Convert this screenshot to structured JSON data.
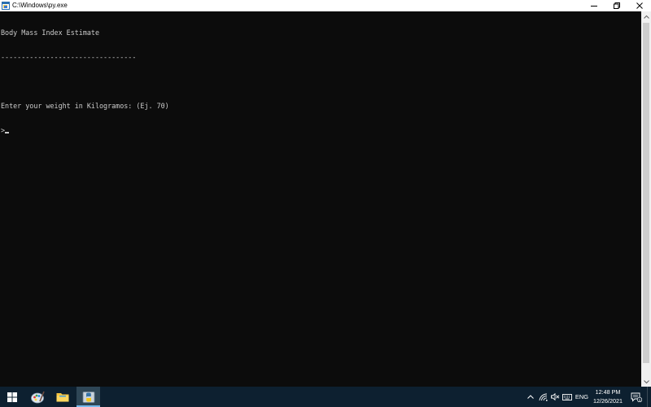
{
  "window": {
    "title": "C:\\Windows\\py.exe",
    "controls": {
      "minimize": "minimize",
      "restore": "restore",
      "close": "close"
    }
  },
  "console": {
    "lines": [
      "Body Mass Index Estimate",
      "---------------------------------",
      "",
      "Enter your weight in Kilogramos: (Ej. 70)"
    ],
    "prompt": ">"
  },
  "taskbar": {
    "apps": [
      {
        "icon": "paint-icon"
      },
      {
        "icon": "file-explorer-icon"
      },
      {
        "icon": "python-icon",
        "active": true
      }
    ],
    "tray": {
      "language": "ENG",
      "time": "12:48 PM",
      "date": "12/26/2021",
      "notification_count": "1"
    }
  },
  "colors": {
    "console_bg": "#0c0c0c",
    "console_fg": "#cccccc",
    "taskbar_bg": "#0d2030",
    "accent": "#76b9ed"
  }
}
